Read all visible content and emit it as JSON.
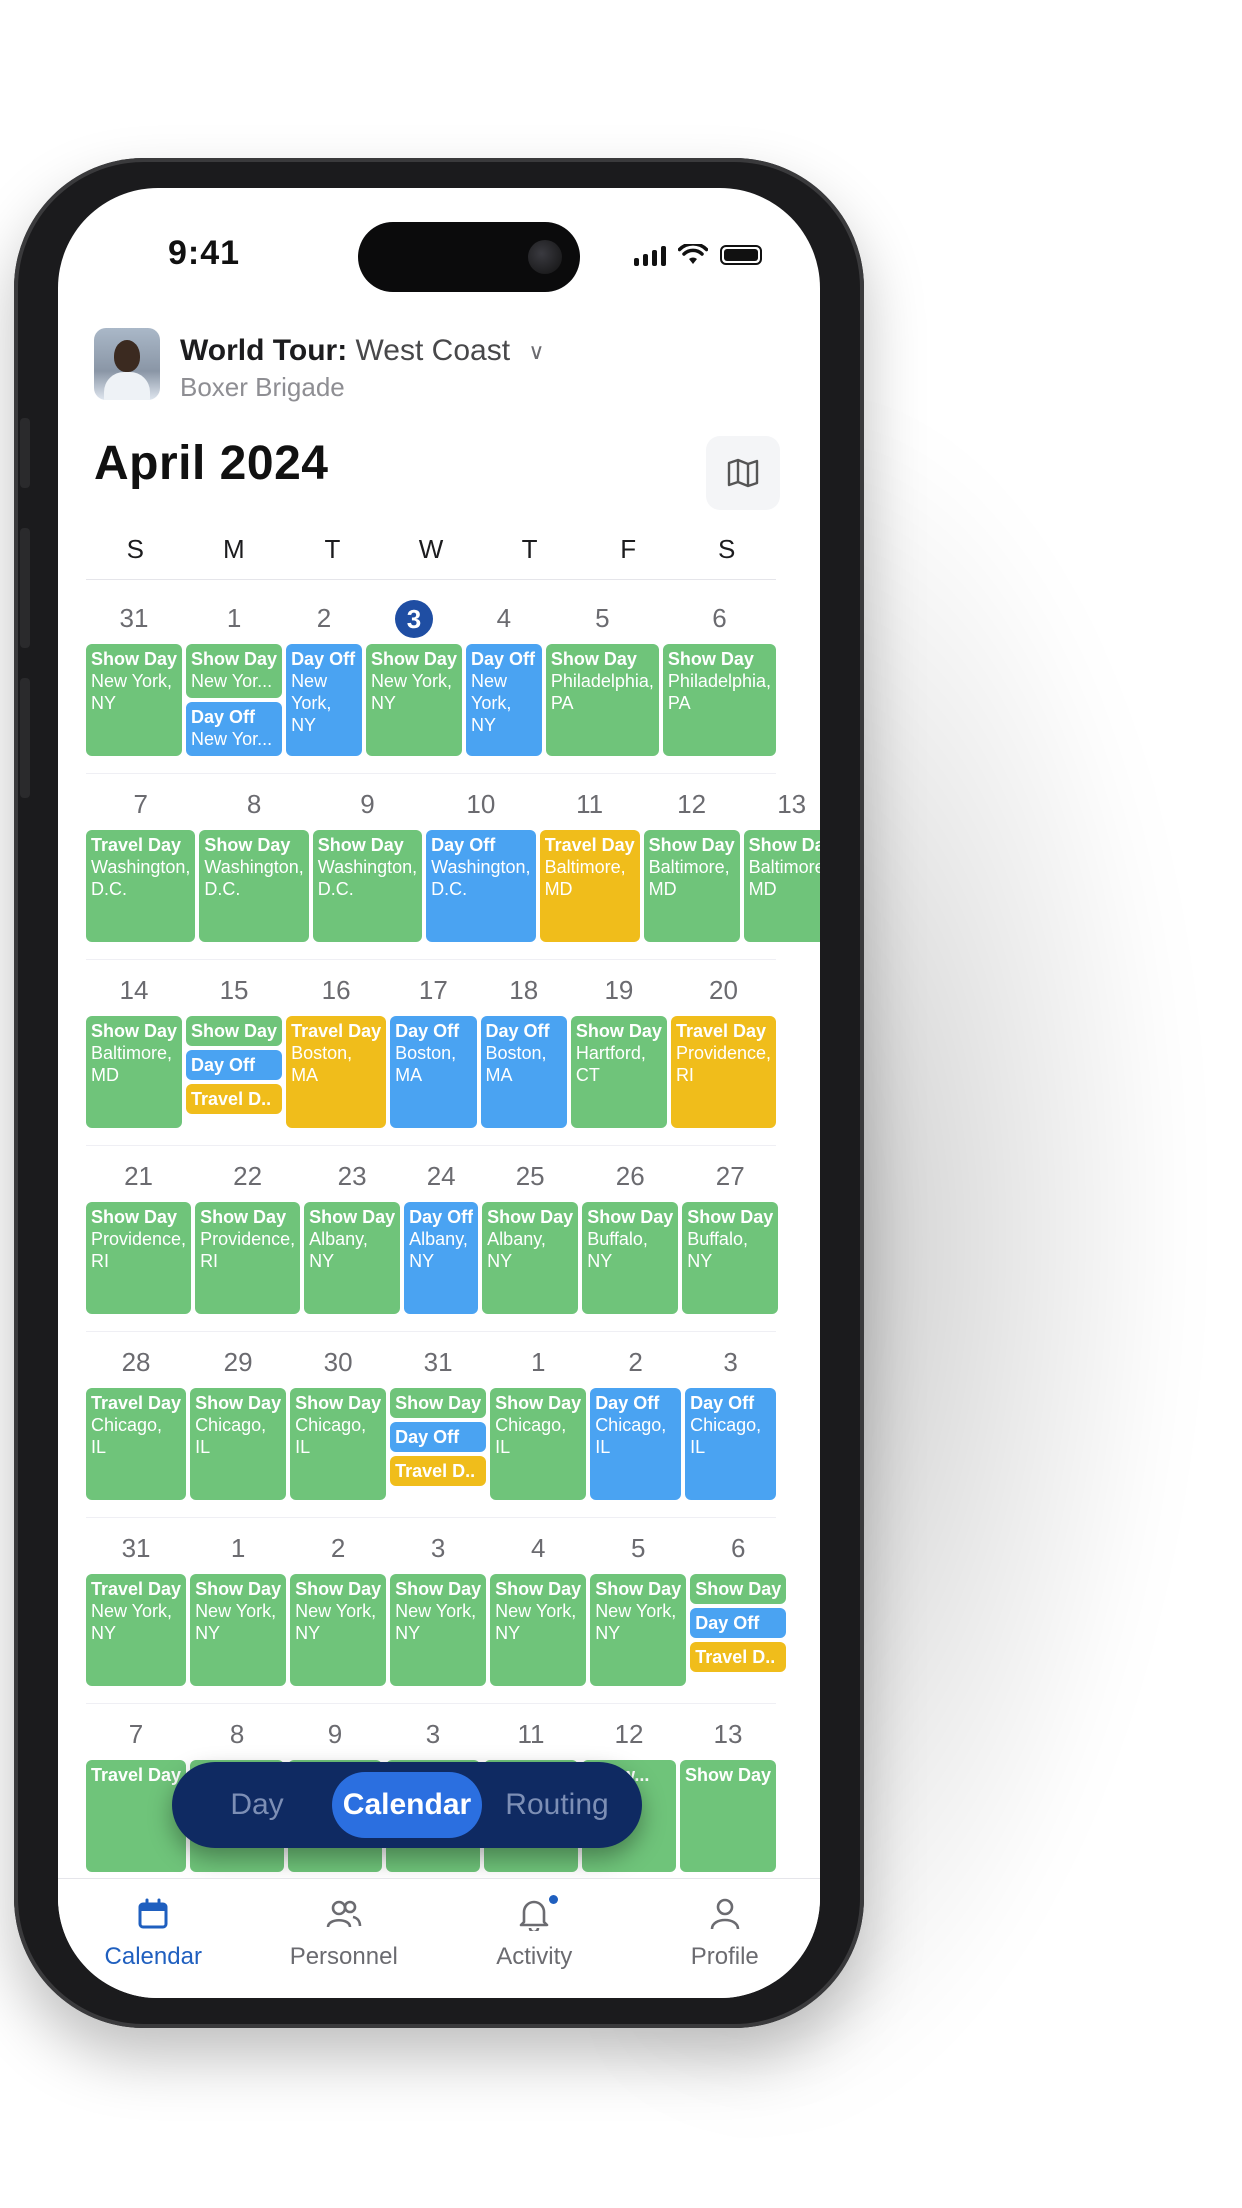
{
  "status": {
    "time": "9:41"
  },
  "header": {
    "tour_name": "World Tour:",
    "leg": "West Coast",
    "artist": "Boxer Brigade"
  },
  "month_title": "April 2024",
  "weekdays": [
    "S",
    "M",
    "T",
    "W",
    "T",
    "F",
    "S"
  ],
  "weeks": [
    [
      {
        "num": "31",
        "events": [
          {
            "label": "Show Day",
            "loc": "New York, NY",
            "color": "green",
            "size": "full"
          }
        ]
      },
      {
        "num": "1",
        "events": [
          {
            "label": "Show Day",
            "loc": "New Yor...",
            "color": "green",
            "size": "half"
          },
          {
            "label": "Day Off",
            "loc": "New Yor...",
            "color": "blue",
            "size": "half"
          }
        ]
      },
      {
        "num": "2",
        "events": [
          {
            "label": "Day Off",
            "loc": "New York, NY",
            "color": "blue",
            "size": "full"
          }
        ]
      },
      {
        "num": "3",
        "today": true,
        "events": [
          {
            "label": "Show Day",
            "loc": "New York, NY",
            "color": "green",
            "size": "full"
          }
        ]
      },
      {
        "num": "4",
        "events": [
          {
            "label": "Day Off",
            "loc": "New York, NY",
            "color": "blue",
            "size": "full"
          }
        ]
      },
      {
        "num": "5",
        "events": [
          {
            "label": "Show Day",
            "loc": "Philadelphia, PA",
            "color": "green",
            "size": "full"
          }
        ]
      },
      {
        "num": "6",
        "events": [
          {
            "label": "Show Day",
            "loc": "Philadelphia, PA",
            "color": "green",
            "size": "full"
          }
        ]
      }
    ],
    [
      {
        "num": "7",
        "events": [
          {
            "label": "Travel Day",
            "loc": "Washington, D.C.",
            "color": "green",
            "size": "full"
          }
        ]
      },
      {
        "num": "8",
        "events": [
          {
            "label": "Show Day",
            "loc": "Washington, D.C.",
            "color": "green",
            "size": "full"
          }
        ]
      },
      {
        "num": "9",
        "events": [
          {
            "label": "Show Day",
            "loc": "Washington, D.C.",
            "color": "green",
            "size": "full"
          }
        ]
      },
      {
        "num": "10",
        "events": [
          {
            "label": "Day Off",
            "loc": "Washington, D.C.",
            "color": "blue",
            "size": "full"
          }
        ]
      },
      {
        "num": "11",
        "events": [
          {
            "label": "Travel Day",
            "loc": "Baltimore, MD",
            "color": "yellow",
            "size": "full"
          }
        ]
      },
      {
        "num": "12",
        "events": [
          {
            "label": "Show Day",
            "loc": "Baltimore, MD",
            "color": "green",
            "size": "full"
          }
        ]
      },
      {
        "num": "13",
        "events": [
          {
            "label": "Show Day",
            "loc": "Baltimore, MD",
            "color": "green",
            "size": "full"
          }
        ]
      }
    ],
    [
      {
        "num": "14",
        "events": [
          {
            "label": "Show Day",
            "loc": "Baltimore, MD",
            "color": "green",
            "size": "full"
          }
        ]
      },
      {
        "num": "15",
        "events": [
          {
            "label": "Show Day",
            "loc": "",
            "color": "green",
            "size": "third"
          },
          {
            "label": "Day Off",
            "loc": "",
            "color": "blue",
            "size": "third"
          },
          {
            "label": "Travel D..",
            "loc": "",
            "color": "yellow",
            "size": "third"
          }
        ]
      },
      {
        "num": "16",
        "events": [
          {
            "label": "Travel Day",
            "loc": "Boston, MA",
            "color": "yellow",
            "size": "full"
          }
        ]
      },
      {
        "num": "17",
        "events": [
          {
            "label": "Day Off",
            "loc": "Boston, MA",
            "color": "blue",
            "size": "full"
          }
        ]
      },
      {
        "num": "18",
        "events": [
          {
            "label": "Day Off",
            "loc": "Boston, MA",
            "color": "blue",
            "size": "full"
          }
        ]
      },
      {
        "num": "19",
        "events": [
          {
            "label": "Show Day",
            "loc": "Hartford, CT",
            "color": "green",
            "size": "full"
          }
        ]
      },
      {
        "num": "20",
        "events": [
          {
            "label": "Travel Day",
            "loc": "Providence, RI",
            "color": "yellow",
            "size": "full"
          }
        ]
      }
    ],
    [
      {
        "num": "21",
        "events": [
          {
            "label": "Show Day",
            "loc": "Providence, RI",
            "color": "green",
            "size": "full"
          }
        ]
      },
      {
        "num": "22",
        "events": [
          {
            "label": "Show Day",
            "loc": "Providence, RI",
            "color": "green",
            "size": "full"
          }
        ]
      },
      {
        "num": "23",
        "events": [
          {
            "label": "Show Day",
            "loc": "Albany, NY",
            "color": "green",
            "size": "full"
          }
        ]
      },
      {
        "num": "24",
        "events": [
          {
            "label": "Day Off",
            "loc": "Albany, NY",
            "color": "blue",
            "size": "full"
          }
        ]
      },
      {
        "num": "25",
        "events": [
          {
            "label": "Show Day",
            "loc": "Albany, NY",
            "color": "green",
            "size": "full"
          }
        ]
      },
      {
        "num": "26",
        "events": [
          {
            "label": "Show Day",
            "loc": "Buffalo, NY",
            "color": "green",
            "size": "full"
          }
        ]
      },
      {
        "num": "27",
        "events": [
          {
            "label": "Show Day",
            "loc": "Buffalo, NY",
            "color": "green",
            "size": "full"
          }
        ]
      }
    ],
    [
      {
        "num": "28",
        "events": [
          {
            "label": "Travel Day",
            "loc": "Chicago, IL",
            "color": "green",
            "size": "full"
          }
        ]
      },
      {
        "num": "29",
        "events": [
          {
            "label": "Show Day",
            "loc": "Chicago, IL",
            "color": "green",
            "size": "full"
          }
        ]
      },
      {
        "num": "30",
        "events": [
          {
            "label": "Show Day",
            "loc": "Chicago, IL",
            "color": "green",
            "size": "full"
          }
        ]
      },
      {
        "num": "31",
        "events": [
          {
            "label": "Show Day",
            "loc": "",
            "color": "green",
            "size": "third"
          },
          {
            "label": "Day Off",
            "loc": "",
            "color": "blue",
            "size": "third"
          },
          {
            "label": "Travel D..",
            "loc": "",
            "color": "yellow",
            "size": "third"
          }
        ]
      },
      {
        "num": "1",
        "events": [
          {
            "label": "Show Day",
            "loc": "Chicago, IL",
            "color": "green",
            "size": "full"
          }
        ]
      },
      {
        "num": "2",
        "events": [
          {
            "label": "Day Off",
            "loc": "Chicago, IL",
            "color": "blue",
            "size": "full"
          }
        ]
      },
      {
        "num": "3",
        "events": [
          {
            "label": "Day Off",
            "loc": "Chicago, IL",
            "color": "blue",
            "size": "full"
          }
        ]
      }
    ],
    [
      {
        "num": "31",
        "events": [
          {
            "label": "Travel Day",
            "loc": "New York, NY",
            "color": "green",
            "size": "full"
          }
        ]
      },
      {
        "num": "1",
        "events": [
          {
            "label": "Show Day",
            "loc": "New York, NY",
            "color": "green",
            "size": "full"
          }
        ]
      },
      {
        "num": "2",
        "events": [
          {
            "label": "Show Day",
            "loc": "New York, NY",
            "color": "green",
            "size": "full"
          }
        ]
      },
      {
        "num": "3",
        "events": [
          {
            "label": "Show Day",
            "loc": "New York, NY",
            "color": "green",
            "size": "full"
          }
        ]
      },
      {
        "num": "4",
        "events": [
          {
            "label": "Show Day",
            "loc": "New York, NY",
            "color": "green",
            "size": "full"
          }
        ]
      },
      {
        "num": "5",
        "events": [
          {
            "label": "Show Day",
            "loc": "New York, NY",
            "color": "green",
            "size": "full"
          }
        ]
      },
      {
        "num": "6",
        "events": [
          {
            "label": "Show Day",
            "loc": "",
            "color": "green",
            "size": "third"
          },
          {
            "label": "Day Off",
            "loc": "",
            "color": "blue",
            "size": "third"
          },
          {
            "label": "Travel D..",
            "loc": "",
            "color": "yellow",
            "size": "third"
          }
        ]
      }
    ],
    [
      {
        "num": "7",
        "events": [
          {
            "label": "Travel Day",
            "loc": "",
            "color": "green",
            "size": "full"
          }
        ]
      },
      {
        "num": "8",
        "events": [
          {
            "label": "Show...",
            "loc": "",
            "color": "green",
            "size": "full"
          }
        ]
      },
      {
        "num": "9",
        "events": [
          {
            "label": "Show...",
            "loc": "",
            "color": "green",
            "size": "full"
          }
        ]
      },
      {
        "num": "3",
        "events": [
          {
            "label": "Show...",
            "loc": "",
            "color": "green",
            "size": "full"
          }
        ]
      },
      {
        "num": "11",
        "events": [
          {
            "label": "Show...",
            "loc": "",
            "color": "green",
            "size": "full"
          }
        ]
      },
      {
        "num": "12",
        "events": [
          {
            "label": "Show...",
            "loc": "",
            "color": "green",
            "size": "full"
          }
        ]
      },
      {
        "num": "13",
        "events": [
          {
            "label": "Show Day",
            "loc": "",
            "color": "green",
            "size": "full"
          }
        ]
      }
    ]
  ],
  "view_toggle": {
    "options": [
      "Day",
      "Calendar",
      "Routing"
    ],
    "active": "Calendar"
  },
  "tabbar": [
    {
      "label": "Calendar",
      "icon": "calendar-icon",
      "active": true
    },
    {
      "label": "Personnel",
      "icon": "people-icon",
      "active": false
    },
    {
      "label": "Activity",
      "icon": "bell-icon",
      "active": false,
      "badge": true
    },
    {
      "label": "Profile",
      "icon": "person-icon",
      "active": false
    }
  ],
  "colors": {
    "show": "#6fc47a",
    "off": "#4aa3f2",
    "travel": "#f0bd1b",
    "accent": "#1f5fbf",
    "today": "#1f4ea3",
    "toggle_bg": "#0f2a62"
  }
}
